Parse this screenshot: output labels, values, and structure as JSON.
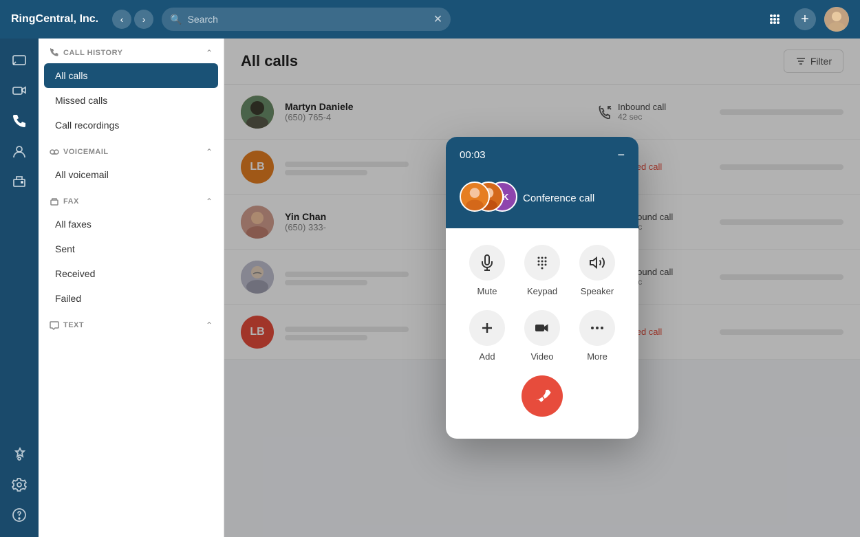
{
  "app": {
    "title": "RingCentral, Inc.",
    "search_placeholder": "Search"
  },
  "topbar": {
    "filter_label": "Filter"
  },
  "sidebar": {
    "sections": [
      {
        "id": "call-history",
        "title": "CALL HISTORY",
        "items": [
          {
            "id": "all-calls",
            "label": "All calls",
            "active": true
          },
          {
            "id": "missed-calls",
            "label": "Missed calls",
            "active": false
          },
          {
            "id": "call-recordings",
            "label": "Call recordings",
            "active": false
          }
        ]
      },
      {
        "id": "voicemail",
        "title": "VOICEMAIL",
        "items": [
          {
            "id": "all-voicemail",
            "label": "All voicemail",
            "active": false
          }
        ]
      },
      {
        "id": "fax",
        "title": "FAX",
        "items": [
          {
            "id": "all-faxes",
            "label": "All faxes",
            "active": false
          },
          {
            "id": "sent",
            "label": "Sent",
            "active": false
          },
          {
            "id": "received",
            "label": "Received",
            "active": false
          },
          {
            "id": "failed",
            "label": "Failed",
            "active": false
          }
        ]
      },
      {
        "id": "text",
        "title": "TEXT",
        "items": []
      }
    ]
  },
  "main": {
    "title": "All calls",
    "calls": [
      {
        "id": 1,
        "name": "Martyn Daniele",
        "number": "(650) 765-4",
        "avatar_text": "",
        "avatar_color": "",
        "avatar_type": "image",
        "call_type": "Inbound call",
        "call_icon": "inbound",
        "duration": "42 sec",
        "missed": false
      },
      {
        "id": 2,
        "name": "",
        "number": "",
        "avatar_text": "LB",
        "avatar_color": "#e67e22",
        "avatar_type": "initials",
        "call_type": "Missed call",
        "call_icon": "missed",
        "duration": "",
        "missed": true
      },
      {
        "id": 3,
        "name": "Yin Chan",
        "number": "(650) 333-",
        "avatar_text": "",
        "avatar_color": "",
        "avatar_type": "image",
        "call_type": "Outbound call",
        "call_icon": "outbound",
        "duration": "42 sec",
        "missed": false
      },
      {
        "id": 4,
        "name": "",
        "number": "",
        "avatar_text": "",
        "avatar_color": "",
        "avatar_type": "image_glasses",
        "call_type": "Outbound call",
        "call_icon": "outbound",
        "duration": "42 sec",
        "missed": false
      },
      {
        "id": 5,
        "name": "",
        "number": "",
        "avatar_text": "LB",
        "avatar_color": "#e74c3c",
        "avatar_type": "initials",
        "call_type": "Missed call",
        "call_icon": "missed",
        "duration": "",
        "missed": true
      }
    ]
  },
  "conference_call": {
    "timer": "00:03",
    "label": "Conference call",
    "actions": {
      "row1": [
        {
          "id": "mute",
          "label": "Mute"
        },
        {
          "id": "keypad",
          "label": "Keypad"
        },
        {
          "id": "speaker",
          "label": "Speaker"
        }
      ],
      "row2": [
        {
          "id": "add",
          "label": "Add"
        },
        {
          "id": "video",
          "label": "Video"
        },
        {
          "id": "more",
          "label": "More"
        }
      ]
    }
  }
}
